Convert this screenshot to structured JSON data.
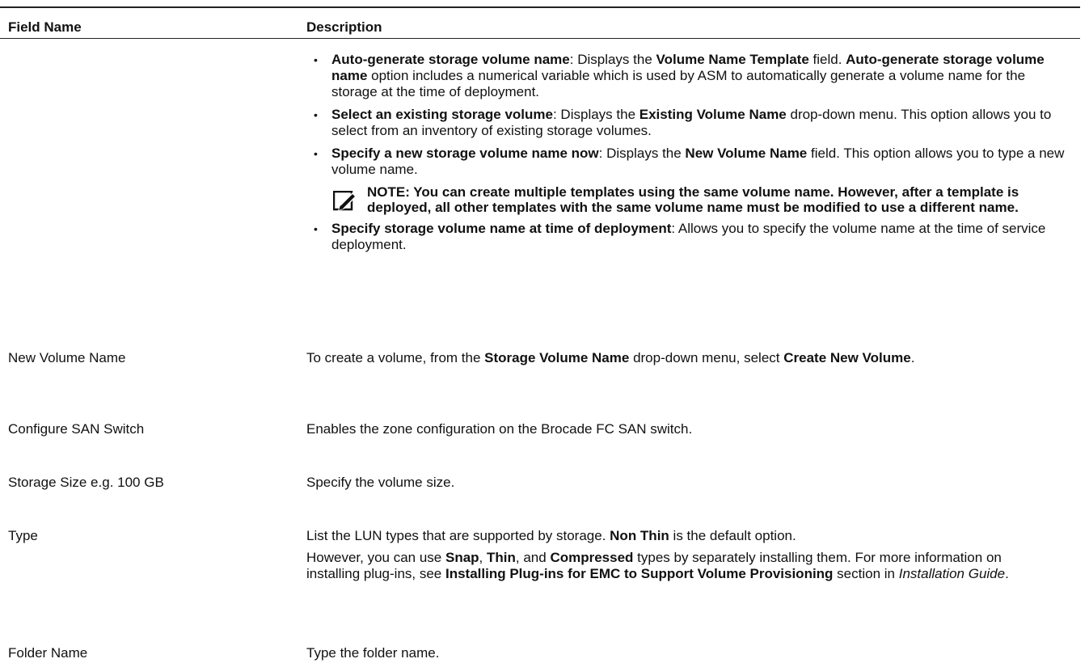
{
  "header": {
    "field_col": "Field Name",
    "desc_col": "Description"
  },
  "storage_volume_options": [
    {
      "bold": "Auto-generate storage volume name",
      "t1": ": Displays the ",
      "b2": "Volume Name Template",
      "t2": " field. ",
      "b3": "Auto-generate storage volume name",
      "t3": " option includes a numerical variable which is used by ASM to automatically generate a volume name for the storage at the time of deployment."
    },
    {
      "bold": "Select an existing storage volume",
      "t1": ": Displays the ",
      "b2": "Existing Volume Name",
      "t2": " drop-down menu. This option allows you to select from an inventory of existing storage volumes."
    },
    {
      "bold": "Specify a new storage volume name now",
      "t1": ": Displays the ",
      "b2": "New Volume Name",
      "t2": " field. This option allows you to type a new volume name."
    },
    {
      "bold": "Specify storage volume name at time of deployment",
      "t1": ": Allows you to specify the volume name at the time of service deployment."
    }
  ],
  "note": {
    "icon": "pencil-note-icon",
    "text": "NOTE: You can create multiple templates using the same volume name. However, after a template is deployed, all other templates with the same volume name must be modified to use a different name."
  },
  "rows": {
    "new_volume": {
      "field": "New Volume Name",
      "t1": "To create a volume, from the ",
      "b1": "Storage Volume Name",
      "t2": " drop-down menu, select ",
      "b2": "Create New Volume",
      "t3": "."
    },
    "san_switch": {
      "field": "Configure SAN Switch",
      "desc": "Enables the zone configuration on the Brocade FC SAN switch."
    },
    "storage_size": {
      "field": "Storage Size e.g. 100 GB",
      "desc": "Specify the volume size."
    },
    "type": {
      "field": "Type",
      "p1_t1": "List the LUN types that are supported by storage. ",
      "p1_b1": "Non Thin",
      "p1_t2": " is the default option.",
      "p2_t1": "However, you can use ",
      "p2_b1": "Snap",
      "p2_t2": ", ",
      "p2_b2": "Thin",
      "p2_t3": ", and ",
      "p2_b3": "Compressed",
      "p2_t4": " types by separately installing them. For more information on installing plug-ins, see ",
      "p2_b4": "Installing Plug-ins for EMC to Support Volume Provisioning",
      "p2_t5": " section in ",
      "p2_i1": "Installation Guide",
      "p2_t6": "."
    },
    "folder": {
      "field": "Folder Name",
      "desc": "Type the folder name."
    }
  }
}
